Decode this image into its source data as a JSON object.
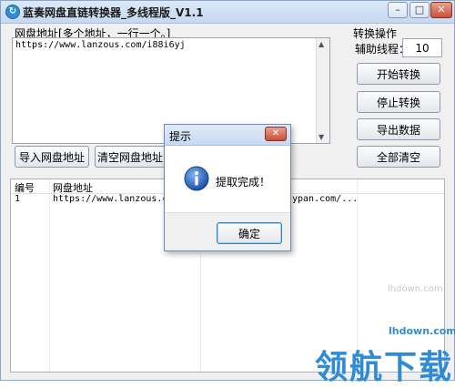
{
  "window": {
    "title": "蓝奏网盘直链转换器_多线程版_V1.1"
  },
  "url_section": {
    "label": "网盘地址[多个地址，一行一个。]",
    "value": "https://www.lanzous.com/i88i6yj",
    "import_button": "导入网盘地址",
    "clear_button": "清空网盘地址"
  },
  "ops": {
    "label": "转换操作",
    "thread_label": "辅助线程：",
    "thread_value": "10",
    "start": "开始转换",
    "stop": "停止转换",
    "export": "导出数据",
    "clear_all": "全部清空"
  },
  "table": {
    "columns": [
      "编号",
      "网盘地址"
    ],
    "rows": [
      {
        "no": "1",
        "url": "https://www.lanzous.com/",
        "result": "ypan.com/..."
      }
    ]
  },
  "dialog": {
    "title": "提示",
    "message": "提取完成！",
    "ok": "确定"
  },
  "watermark": {
    "brand": "领航下载",
    "url": "lhdown.com",
    "faint": "lhdown.com"
  },
  "colors": {
    "brand": "#2f8bd6",
    "title_bar": "#c6d9f1",
    "close": "#c9503b"
  }
}
